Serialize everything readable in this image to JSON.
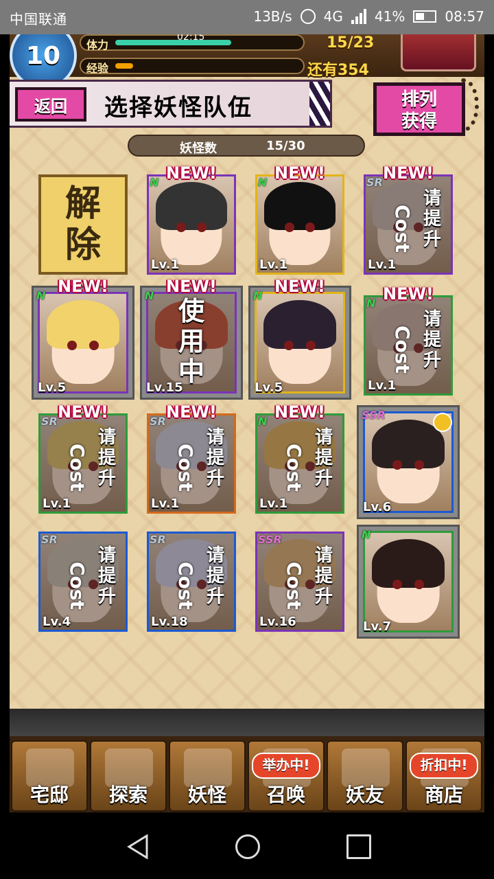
{
  "status_bar": {
    "carrier": "中国联通",
    "speed": "13B/s",
    "network": "4G",
    "battery": "41%",
    "time": "08:57"
  },
  "player": {
    "level": "10",
    "stamina_label": "体力",
    "stamina_timer": "02:15",
    "stamina_value": "15/23",
    "stamina_fraction": 0.65,
    "exp_label": "经验",
    "exp_remaining": "还有354",
    "exp_fraction": 0.1
  },
  "header": {
    "back_label": "返回",
    "title": "选择妖怪队伍",
    "sort_line1": "排列",
    "sort_line2": "获得"
  },
  "monster_count": {
    "label": "妖怪数",
    "value": "15/30"
  },
  "release": {
    "line1": "解",
    "line2": "除"
  },
  "cards": [
    {
      "new": "NEW!",
      "rarity": "N",
      "lv": "Lv.1",
      "frame": "r-purple",
      "hair": "#333",
      "dim": false,
      "framed": false
    },
    {
      "new": "NEW!",
      "rarity": "N",
      "lv": "Lv.1",
      "frame": "r-yellow",
      "hair": "#111",
      "dim": false,
      "framed": false
    },
    {
      "new": "NEW!",
      "rarity": "SR",
      "lv": "Lv.1",
      "frame": "r-purple",
      "hair": "#c8b8b0",
      "dim": true,
      "framed": false,
      "cost": "请提升",
      "cost_word": "Cost"
    },
    {
      "new": "NEW!",
      "rarity": "N",
      "lv": "Lv.5",
      "frame": "r-purple",
      "hair": "#f2d26a",
      "dim": false,
      "framed": true
    },
    {
      "new": "NEW!",
      "rarity": "N",
      "lv": "Lv.15",
      "frame": "r-purple",
      "hair": "#c84a2a",
      "dim": true,
      "framed": true,
      "in_use": "使用中"
    },
    {
      "new": "NEW!",
      "rarity": "N",
      "lv": "Lv.5",
      "frame": "r-yellow",
      "hair": "#2a2030",
      "dim": false,
      "framed": true
    },
    {
      "new": "NEW!",
      "rarity": "N",
      "lv": "Lv.1",
      "frame": "r-green",
      "hair": "#c8b0a0",
      "dim": true,
      "framed": false,
      "cost": "请提升",
      "cost_word": "Cost"
    },
    {
      "new": "NEW!",
      "rarity": "SR",
      "lv": "Lv.1",
      "frame": "r-green",
      "hair": "#e0c060",
      "dim": true,
      "framed": false,
      "cost": "请提升",
      "cost_word": "Cost"
    },
    {
      "new": "NEW!",
      "rarity": "SR",
      "lv": "Lv.1",
      "frame": "r-orange",
      "hair": "#d0d0e0",
      "dim": true,
      "framed": false,
      "cost": "请提升",
      "cost_word": "Cost"
    },
    {
      "new": "NEW!",
      "rarity": "N",
      "lv": "Lv.1",
      "frame": "r-green",
      "hair": "#e0b050",
      "dim": true,
      "framed": false,
      "cost": "请提升",
      "cost_word": "Cost"
    },
    {
      "new": "",
      "rarity": "SSR",
      "lv": "Lv.6",
      "frame": "r-blue",
      "hair": "#2a2020",
      "dim": false,
      "framed": true,
      "medal": true
    },
    {
      "new": "",
      "rarity": "SR",
      "lv": "Lv.4",
      "frame": "r-blue",
      "hair": "#c8c0b0",
      "dim": true,
      "framed": false,
      "cost": "请提升",
      "cost_word": "Cost"
    },
    {
      "new": "",
      "rarity": "SR",
      "lv": "Lv.18",
      "frame": "r-blue",
      "hair": "#d0d0e8",
      "dim": true,
      "framed": false,
      "cost": "请提升",
      "cost_word": "Cost"
    },
    {
      "new": "",
      "rarity": "SSR",
      "lv": "Lv.16",
      "frame": "r-purple",
      "hair": "#e0b070",
      "dim": true,
      "framed": false,
      "cost": "请提升",
      "cost_word": "Cost"
    },
    {
      "new": "",
      "rarity": "N",
      "lv": "Lv.7",
      "frame": "r-green",
      "hair": "#2a1a18",
      "dim": false,
      "framed": true
    }
  ],
  "nav": [
    {
      "label": "宅邸",
      "badge": ""
    },
    {
      "label": "探索",
      "badge": ""
    },
    {
      "label": "妖怪",
      "badge": ""
    },
    {
      "label": "召唤",
      "badge": "举办中!"
    },
    {
      "label": "妖友",
      "badge": ""
    },
    {
      "label": "商店",
      "badge": "折扣中!"
    }
  ]
}
